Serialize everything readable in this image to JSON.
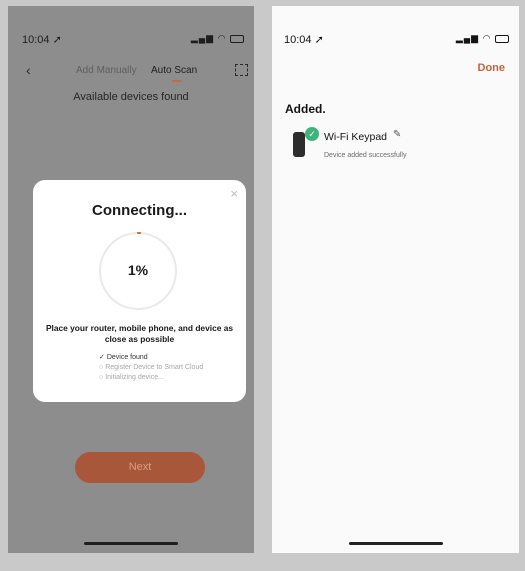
{
  "left": {
    "status_time": "10:04",
    "back_glyph": "‹",
    "tabs": [
      "Add Manually",
      "Auto Scan"
    ],
    "subtitle": "Available devices found",
    "modal": {
      "close_glyph": "×",
      "title": "Connecting...",
      "progress_text": "1%",
      "progress": 0.01,
      "tip": "Place your router, mobile phone, and device as close as possible",
      "steps": [
        {
          "mark": "✓",
          "label": "Device found"
        },
        {
          "mark": "○",
          "label": "Register Device to Smart Cloud"
        },
        {
          "mark": "○",
          "label": "Initializing device..."
        }
      ]
    },
    "next_button": "Next"
  },
  "right": {
    "status_time": "10:04",
    "done_button": "Done",
    "section_title": "Added.",
    "device": {
      "name": "Wi-Fi Keypad",
      "status": "Device added successfully",
      "check_glyph": "✓",
      "edit_glyph": "✎"
    }
  },
  "colors": {
    "accent": "#c2643c",
    "success": "#3fb37c",
    "overlay_bg": "#8d8d8d"
  },
  "icons": [
    "location-arrow-icon",
    "signal-icon",
    "wifi-icon",
    "battery-icon",
    "back-chevron-icon",
    "scan-icon",
    "close-icon",
    "checkmark-icon",
    "circle-icon",
    "phone-device-icon",
    "pencil-edit-icon"
  ]
}
